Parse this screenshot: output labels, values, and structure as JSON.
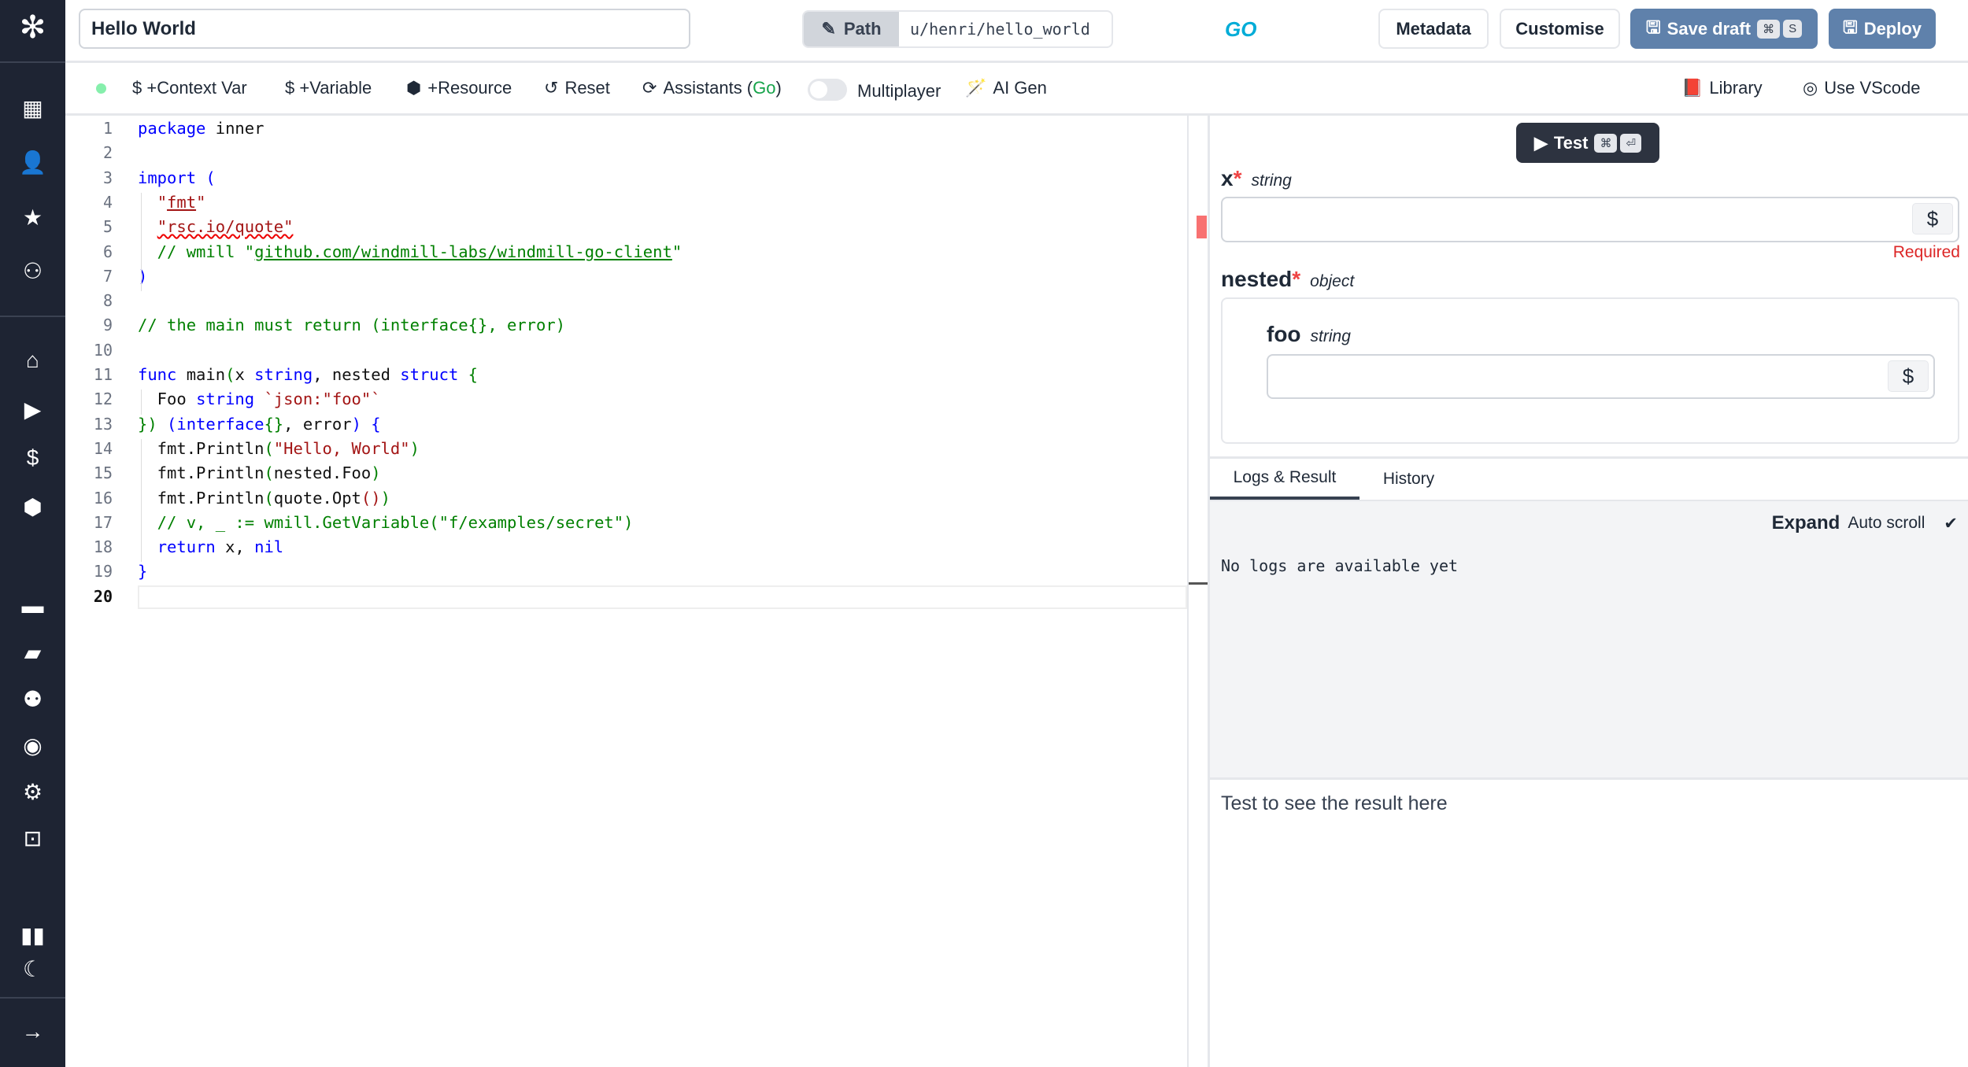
{
  "sidebar": {
    "icons": [
      "windmill-logo-icon",
      "building-icon",
      "user-icon",
      "star-icon",
      "users-icon",
      "home-icon",
      "play-icon",
      "dollar-icon",
      "cubes-icon",
      "calendar-icon",
      "folder-open-icon",
      "users-cog-icon",
      "eye-icon",
      "gear-icon",
      "robot-icon",
      "book-open-icon",
      "moon-icon",
      "arrow-right-icon"
    ]
  },
  "header": {
    "title": "Hello World",
    "path_label": "Path",
    "path_value": "u/henri/hello_world",
    "language_logo": "GO",
    "metadata": "Metadata",
    "customise": "Customise",
    "save_draft": "Save draft",
    "save_kbd1": "⌘",
    "save_kbd2": "S",
    "deploy": "Deploy",
    "accent": "#5f81ab"
  },
  "toolbar": {
    "context_var": "$ +Context Var",
    "variable": "$ +Variable",
    "resource": "+Resource",
    "reset": "Reset",
    "assistants": "Assistants (",
    "assistants_lang": "Go",
    "assistants_end": ")",
    "multiplayer": "Multiplayer",
    "multiplayer_on": false,
    "ai_gen": "AI Gen",
    "library": "Library",
    "vscode": "Use VScode",
    "status_color": "#86efac"
  },
  "editor": {
    "active_line": "20",
    "lines": [
      [
        [
          "package",
          "k"
        ],
        [
          " inner",
          ""
        ]
      ],
      [],
      [
        [
          "import",
          "k"
        ],
        [
          " (",
          "k"
        ]
      ],
      [
        [
          "  ",
          ""
        ],
        [
          "\"",
          "s"
        ],
        [
          "fmt",
          "s u"
        ],
        [
          "\"",
          "s"
        ]
      ],
      [
        [
          "  ",
          ""
        ],
        [
          "\"rsc.io/quote\"",
          "s sq"
        ]
      ],
      [
        [
          "  // wmill \"",
          "c"
        ],
        [
          "github.com/windmill-labs/windmill-go-client",
          "c u"
        ],
        [
          "\"",
          "c"
        ]
      ],
      [
        [
          ")",
          "k"
        ]
      ],
      [],
      [
        [
          "// the main must return (interface{}, error)",
          "c"
        ]
      ],
      [],
      [
        [
          "func",
          "k"
        ],
        [
          " main",
          ""
        ],
        [
          "(",
          "c"
        ],
        [
          "x ",
          ""
        ],
        [
          "string",
          "k"
        ],
        [
          ", nested ",
          ""
        ],
        [
          "struct",
          "k"
        ],
        [
          " {",
          "c"
        ]
      ],
      [
        [
          "  Foo ",
          ""
        ],
        [
          "string",
          "k"
        ],
        [
          " `json:\"foo\"`",
          "s"
        ]
      ],
      [
        [
          "})",
          "c"
        ],
        [
          " (",
          "k"
        ],
        [
          "interface",
          "k"
        ],
        [
          "{}",
          "c"
        ],
        [
          ", error",
          ""
        ],
        [
          ")",
          "k"
        ],
        [
          " {",
          "k"
        ]
      ],
      [
        [
          "  fmt.Println",
          ""
        ],
        [
          "(",
          "c"
        ],
        [
          "\"Hello, World\"",
          "s"
        ],
        [
          ")",
          "c"
        ]
      ],
      [
        [
          "  fmt.Println",
          ""
        ],
        [
          "(",
          "c"
        ],
        [
          "nested.Foo",
          ""
        ],
        [
          ")",
          "c"
        ]
      ],
      [
        [
          "  fmt.Println",
          ""
        ],
        [
          "(",
          "c"
        ],
        [
          "quote.Opt",
          ""
        ],
        [
          "()",
          "s"
        ],
        [
          ")",
          "c"
        ]
      ],
      [
        [
          "  // v, _ := wmill.GetVariable(\"f/examples/secret\")",
          "c"
        ]
      ],
      [
        [
          "  ",
          ""
        ],
        [
          "return",
          "k"
        ],
        [
          " x, ",
          ""
        ],
        [
          "nil",
          "k"
        ]
      ],
      [
        [
          "}",
          "k"
        ]
      ],
      []
    ]
  },
  "right": {
    "test": "Test",
    "test_kbd1": "⌘",
    "test_kbd2": "⏎",
    "x_label": "x",
    "x_type": "string",
    "required": "Required",
    "nested_label": "nested",
    "nested_type": "object",
    "foo_label": "foo",
    "foo_type": "string",
    "dollar": "$",
    "star": "*",
    "tabs": [
      "Logs & Result",
      "History"
    ],
    "expand": "Expand",
    "auto_scroll": "Auto scroll",
    "check": "✔",
    "no_logs": "No logs are available yet",
    "result_placeholder": "Test to see the result here"
  }
}
